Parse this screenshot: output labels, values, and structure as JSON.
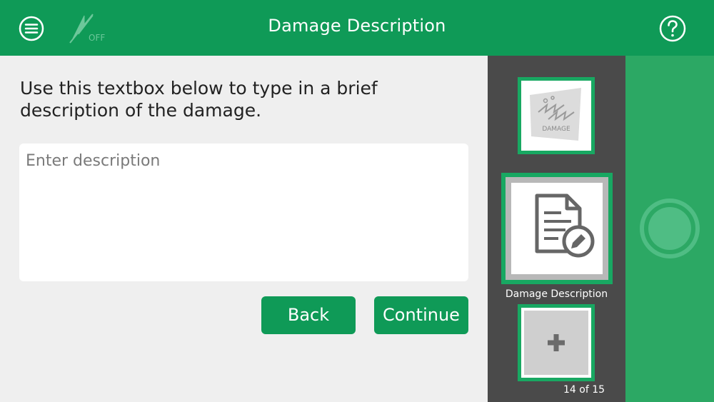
{
  "header": {
    "title": "Damage Description",
    "menu_icon": "hamburger-menu-icon",
    "flash_icon": "flash-off-icon",
    "flash_state_label": "OFF",
    "help_icon": "help-question-icon"
  },
  "main": {
    "instructions": "Use this textbox below to type in a brief description of the damage.",
    "description_placeholder": "Enter description",
    "description_value": "",
    "back_label": "Back",
    "continue_label": "Continue"
  },
  "thumbnails": {
    "items": [
      {
        "caption": "DAMAGE",
        "icon": "damage-photo-icon"
      },
      {
        "label": "Damage Description",
        "icon": "document-edit-icon",
        "selected": true
      },
      {
        "icon": "add-plus-icon"
      }
    ],
    "counter": "14 of 15"
  },
  "capture": {
    "shutter_icon": "shutter-button-icon"
  },
  "colors": {
    "header_green": "#0f9a57",
    "accent_green": "#18a862",
    "strip_gray": "#4a4a4a",
    "capture_green": "#2ca864"
  }
}
